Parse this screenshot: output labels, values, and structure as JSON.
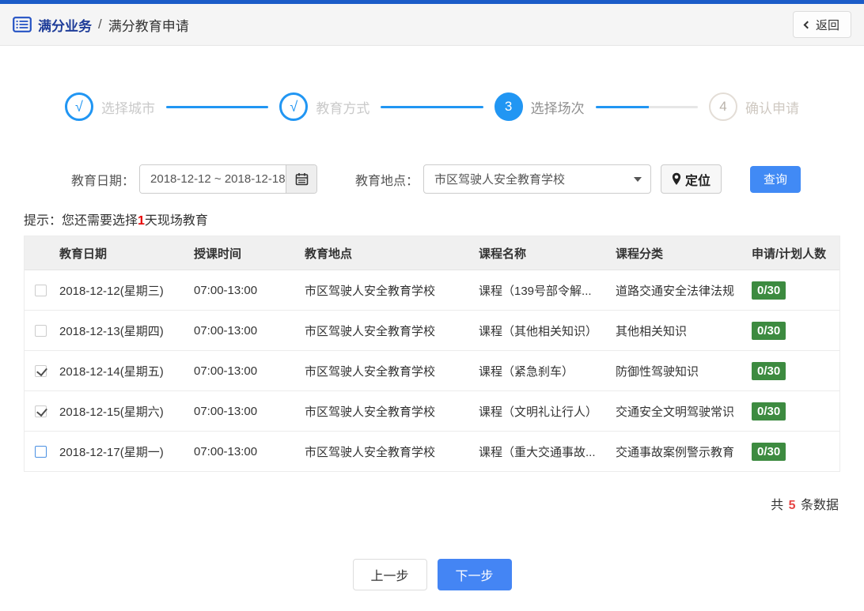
{
  "header": {
    "breadcrumb_primary": "满分业务",
    "breadcrumb_separator": "/",
    "breadcrumb_secondary": "满分教育申请",
    "back_label": "返回"
  },
  "steps": [
    {
      "mark": "√",
      "label": "选择城市",
      "status": "done"
    },
    {
      "mark": "√",
      "label": "教育方式",
      "status": "done"
    },
    {
      "mark": "3",
      "label": "选择场次",
      "status": "active"
    },
    {
      "mark": "4",
      "label": "确认申请",
      "status": "pending"
    }
  ],
  "filters": {
    "date_label": "教育日期：",
    "date_value": "2018-12-12 ~ 2018-12-18",
    "location_label": "教育地点：",
    "location_value": "市区驾驶人安全教育学校",
    "locate_label": "定位",
    "search_label": "查询"
  },
  "hint": {
    "prefix": "提示：您还需要选择",
    "highlight": "1",
    "suffix": "天现场教育"
  },
  "table": {
    "columns": [
      "教育日期",
      "授课时间",
      "教育地点",
      "课程名称",
      "课程分类",
      "申请/计划人数"
    ],
    "rows": [
      {
        "state": "unchecked",
        "date": "2018-12-12(星期三)",
        "time": "07:00-13:00",
        "place": "市区驾驶人安全教育学校",
        "course": "课程（139号部令解...",
        "category": "道路交通安全法律法规",
        "quota": "0/30"
      },
      {
        "state": "unchecked",
        "date": "2018-12-13(星期四)",
        "time": "07:00-13:00",
        "place": "市区驾驶人安全教育学校",
        "course": "课程（其他相关知识）",
        "category": "其他相关知识",
        "quota": "0/30"
      },
      {
        "state": "checked",
        "date": "2018-12-14(星期五)",
        "time": "07:00-13:00",
        "place": "市区驾驶人安全教育学校",
        "course": "课程（紧急刹车）",
        "category": "防御性驾驶知识",
        "quota": "0/30"
      },
      {
        "state": "checked",
        "date": "2018-12-15(星期六)",
        "time": "07:00-13:00",
        "place": "市区驾驶人安全教育学校",
        "course": "课程（文明礼让行人）",
        "category": "交通安全文明驾驶常识",
        "quota": "0/30"
      },
      {
        "state": "unchecked-active",
        "date": "2018-12-17(星期一)",
        "time": "07:00-13:00",
        "place": "市区驾驶人安全教育学校",
        "course": "课程（重大交通事故...",
        "category": "交通事故案例警示教育",
        "quota": "0/30"
      }
    ]
  },
  "summary": {
    "prefix": "共",
    "count": "5",
    "suffix": "条数据"
  },
  "footer": {
    "prev_label": "上一步",
    "next_label": "下一步"
  },
  "colors": {
    "topbar_blue": "#1b5cc8",
    "step_blue": "#2196f3",
    "button_blue": "#4485f4",
    "badge_green": "#3d8b40",
    "highlight_red": "#e60000",
    "count_red": "#e64545"
  }
}
